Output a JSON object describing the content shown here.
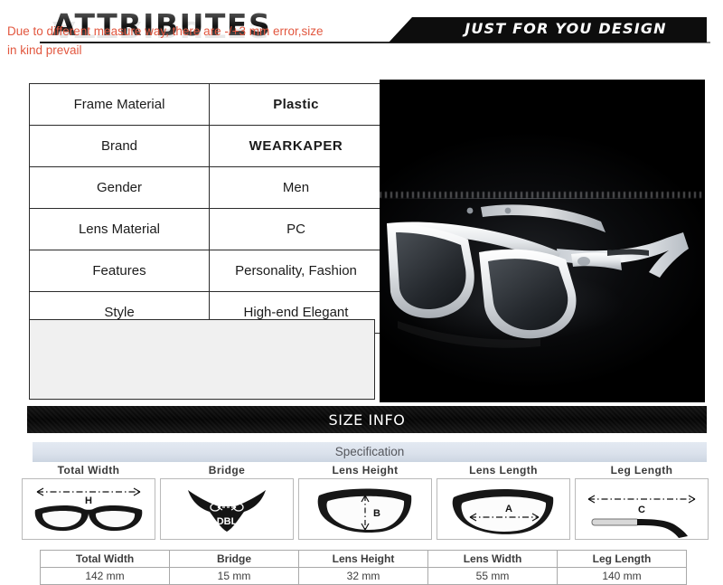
{
  "header": {
    "title": "ATTRIBUTES",
    "banner_text": "JUST FOR YOU DESIGN"
  },
  "attributes": {
    "rows": [
      {
        "label": "Frame Material",
        "value": "Plastic"
      },
      {
        "label": "Brand",
        "value": "WEARKAPER"
      },
      {
        "label": "Gender",
        "value": "Men"
      },
      {
        "label": "Lens Material",
        "value": "PC"
      },
      {
        "label": "Features",
        "value": "Personality, Fashion"
      },
      {
        "label": "Style",
        "value": "High-end Elegant"
      }
    ]
  },
  "note": {
    "text": "Due to different measure way, there are -/+3 mm error,size in kind prevail",
    "color": "#e2573f"
  },
  "size_info": {
    "banner_title": "SIZE INFO",
    "spec_label": "Specification"
  },
  "diagrams": [
    {
      "title": "Total Width",
      "marker": "H",
      "icon": "glasses-front-icon"
    },
    {
      "title": "Bridge",
      "marker": "DBL",
      "icon": "glasses-bridge-icon"
    },
    {
      "title": "Lens Height",
      "marker": "B",
      "icon": "lens-height-icon"
    },
    {
      "title": "Lens Length",
      "marker": "A",
      "icon": "lens-length-icon"
    },
    {
      "title": "Leg Length",
      "marker": "C",
      "icon": "temple-arm-icon"
    }
  ],
  "measurements": {
    "headers": [
      "Total Width",
      "Bridge",
      "Lens Height",
      "Lens Width",
      "Leg Length"
    ],
    "values": [
      "142 mm",
      "15 mm",
      "32 mm",
      "55 mm",
      "140 mm"
    ]
  },
  "colors": {
    "brand_red": "#e02020",
    "note_red": "#e2573f",
    "banner_black": "#0d0d0d",
    "spec_bar": "#dbe2ec"
  }
}
